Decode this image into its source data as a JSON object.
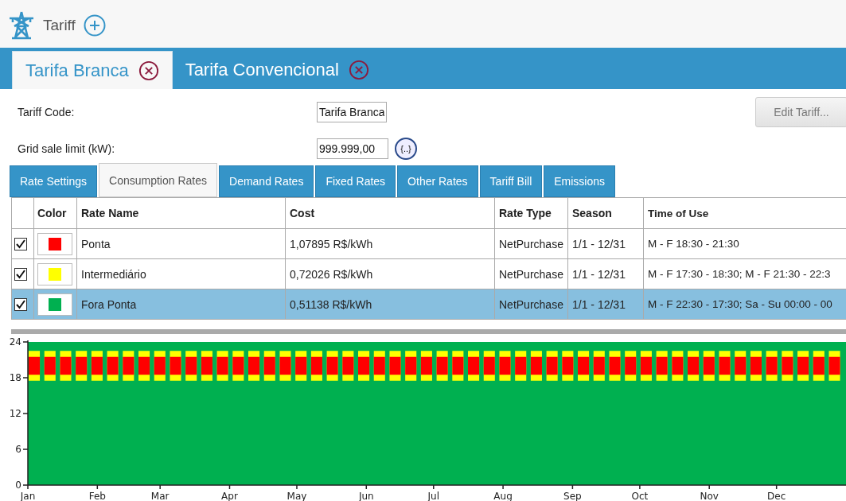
{
  "header": {
    "title": "Tariff"
  },
  "tariff_tabs": [
    {
      "label": "Tarifa Branca",
      "selected": true
    },
    {
      "label": "Tarifa Convencional",
      "selected": false
    }
  ],
  "form": {
    "tariff_code_label": "Tariff Code:",
    "tariff_code": "Tarifa Branca",
    "grid_limit_label": "Grid sale limit (kW):",
    "grid_limit": "999.999,00",
    "expr_button": "{..}",
    "edit_button": "Edit Tariff..."
  },
  "section_tabs": [
    {
      "label": "Rate Settings",
      "selected": false
    },
    {
      "label": "Consumption Rates",
      "selected": true
    },
    {
      "label": "Demand Rates",
      "selected": false
    },
    {
      "label": "Fixed Rates",
      "selected": false
    },
    {
      "label": "Other Rates",
      "selected": false
    },
    {
      "label": "Tariff Bill",
      "selected": false
    },
    {
      "label": "Emissions",
      "selected": false
    }
  ],
  "table": {
    "columns": [
      "Color",
      "Rate Name",
      "Cost",
      "Rate Type",
      "Season",
      "Time of Use"
    ],
    "rows": [
      {
        "checked": true,
        "color": "#ff0000",
        "name": "Ponta",
        "cost": "1,07895 R$/kWh",
        "rate_type": "NetPurchase",
        "season": "1/1 - 12/31",
        "time_of_use": "M - F 18:30 - 21:30",
        "selected": false
      },
      {
        "checked": true,
        "color": "#ffff00",
        "name": "Intermediário",
        "cost": "0,72026 R$/kWh",
        "rate_type": "NetPurchase",
        "season": "1/1 - 12/31",
        "time_of_use": "M - F 17:30 - 18:30; M - F 21:30 - 22:3",
        "selected": false
      },
      {
        "checked": true,
        "color": "#00b050",
        "name": "Fora Ponta",
        "cost": "0,51138 R$/kWh",
        "rate_type": "NetPurchase",
        "season": "1/1 - 12/31",
        "time_of_use": "M - F 22:30 - 17:30; Sa - Su 00:00 - 00",
        "selected": true
      }
    ]
  },
  "chart": {
    "yticks": [
      "24",
      "18",
      "12",
      "6",
      "0"
    ],
    "months": [
      "Jan",
      "Feb",
      "Mar",
      "Apr",
      "May",
      "Jun",
      "Jul",
      "Aug",
      "Sep",
      "Oct",
      "Nov",
      "Dec"
    ]
  }
}
